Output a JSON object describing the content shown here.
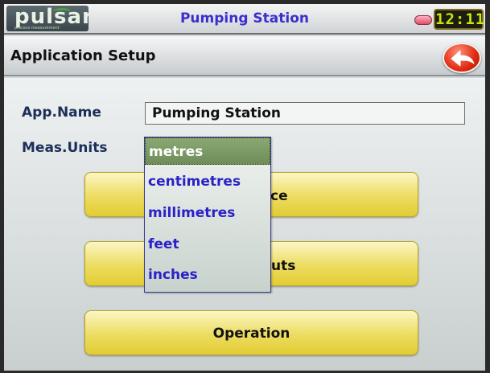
{
  "titlebar": {
    "logo_text": "pulsar",
    "logo_subtext": "process measurement",
    "title": "Pumping Station",
    "clock": "12:11"
  },
  "header": {
    "page_title": "Application Setup"
  },
  "form": {
    "app_name_label": "App.Name",
    "app_name_value": "Pumping Station",
    "units_label": "Meas.Units"
  },
  "units_dropdown": {
    "selected": "metres",
    "options": [
      "metres",
      "centimetres",
      "millimetres",
      "feet",
      "inches"
    ]
  },
  "buttons": {
    "btn1_visible_text": "ce",
    "btn2_visible_text": "uts",
    "operation": "Operation"
  },
  "colors": {
    "title_blue": "#3b2fd0",
    "option_blue": "#2a22c8",
    "button_yellow": "#eddc60",
    "selected_green": "#7a9863",
    "back_red": "#e02b10"
  }
}
